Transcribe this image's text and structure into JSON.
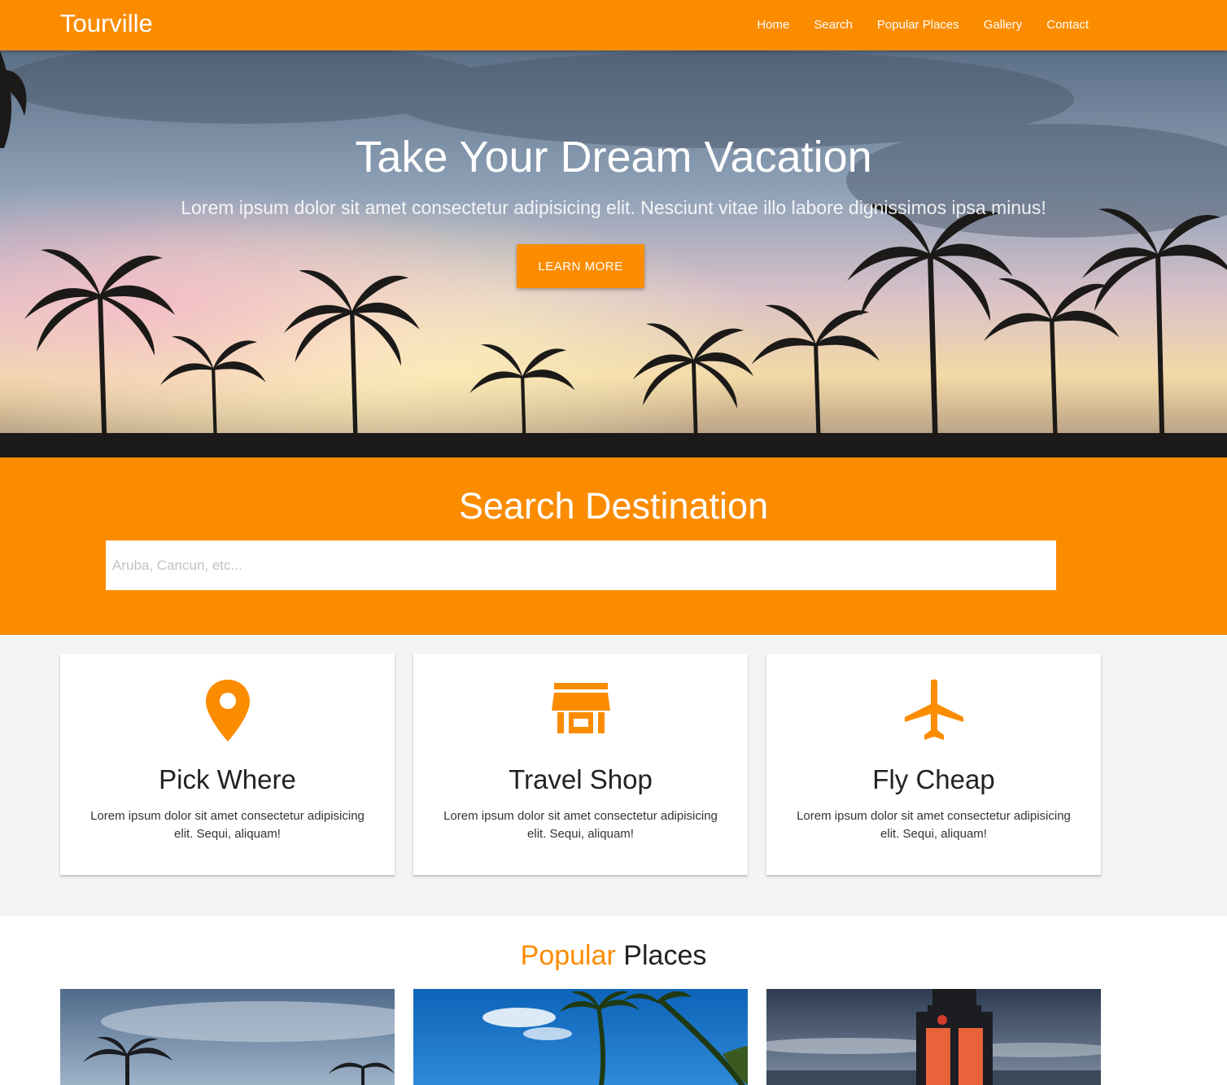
{
  "nav": {
    "brand": "Tourville",
    "links": [
      "Home",
      "Search",
      "Popular Places",
      "Gallery",
      "Contact"
    ]
  },
  "hero": {
    "title": "Take Your Dream Vacation",
    "subtitle": "Lorem ipsum dolor sit amet consectetur adipisicing elit. Nesciunt vitae illo labore dignissimos ipsa minus!",
    "button_label": "LEARN MORE"
  },
  "search": {
    "title": "Search Destination",
    "placeholder": "Aruba, Cancun, etc..."
  },
  "features": [
    {
      "icon": "map-pin-icon",
      "title": "Pick Where",
      "text": "Lorem ipsum dolor sit amet consectetur adipisicing elit. Sequi, aliquam!"
    },
    {
      "icon": "store-icon",
      "title": "Travel Shop",
      "text": "Lorem ipsum dolor sit amet consectetur adipisicing elit. Sequi, aliquam!"
    },
    {
      "icon": "airplane-icon",
      "title": "Fly Cheap",
      "text": "Lorem ipsum dolor sit amet consectetur adipisicing elit. Sequi, aliquam!"
    }
  ],
  "popular": {
    "title_accent": "Popular",
    "title_rest": "Places"
  },
  "colors": {
    "accent": "#fb8c00",
    "background": "#f4f4f4"
  }
}
